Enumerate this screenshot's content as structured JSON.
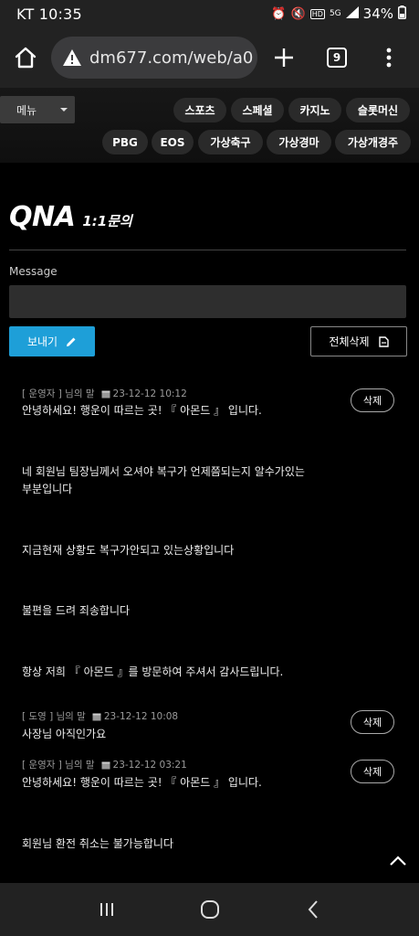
{
  "status_bar": {
    "time": "KT 10:35",
    "battery": "34%",
    "icons": [
      "alarm-icon",
      "mute-icon",
      "hd-icon",
      "5g-signal-icon",
      "signal-icon",
      "battery-icon"
    ]
  },
  "browser": {
    "url": "dm677.com/web/a0",
    "tab_count": "9"
  },
  "site_nav": {
    "menu_label": "메뉴",
    "row1": [
      "스포츠",
      "스페셜",
      "카지노",
      "슬롯머신"
    ],
    "row2": [
      "PBG",
      "EOS",
      "가상축구",
      "가상경마",
      "가상개경주"
    ]
  },
  "page": {
    "title": "QNA",
    "subtitle": "1:1문의",
    "message_label": "Message",
    "message_value": "",
    "send_label": "보내기",
    "delete_all_label": "전체삭제",
    "delete_label": "삭제"
  },
  "messages": [
    {
      "meta_name": "[ 운영자 ] 님의 말",
      "date": "23-12-12 10:12",
      "lines": [
        "안녕하세요! 행운이 따르는 곳! 『 아몬드 』 입니다.",
        "네 회원님 팀장님께서 오셔야 복구가 언제쯤되는지 알수가있는",
        "부분입니다",
        "지금현재 상황도 복구가안되고 있는상황입니다",
        "불편을 드려 죄송합니다",
        "항상 저희 『 아몬드 』를 방문하여 주셔서 감사드립니다."
      ]
    },
    {
      "meta_name": "[ 도영 ] 님의 말",
      "date": "23-12-12 10:08",
      "lines": [
        "사장님 아직인가요"
      ]
    },
    {
      "meta_name": "[ 운영자 ] 님의 말",
      "date": "23-12-12 03:21",
      "lines": [
        "안녕하세요! 행운이 따르는 곳! 『 아몬드 』 입니다.",
        "회원님 환전 취소는 불가능합니다"
      ]
    }
  ]
}
